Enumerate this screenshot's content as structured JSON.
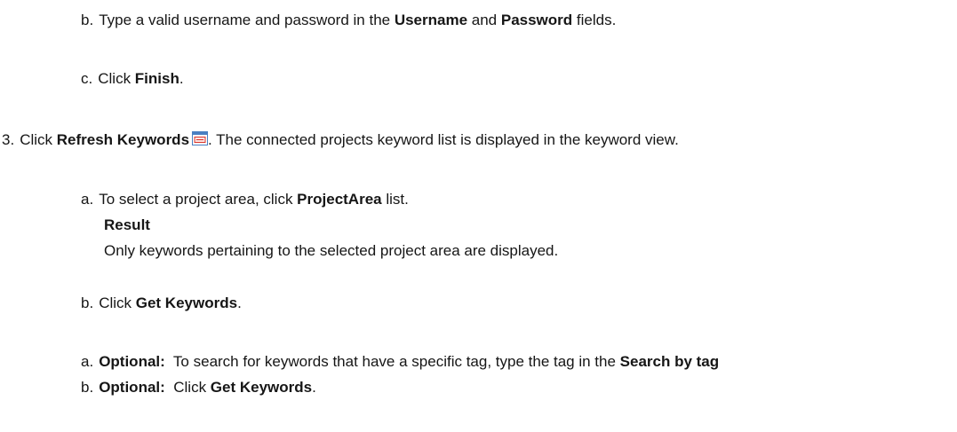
{
  "steps": {
    "b_login": {
      "marker": "b.",
      "t1": "Type a valid username and password in the ",
      "b1": "Username",
      "t2": " and ",
      "b2": "Password",
      "t3": " fields."
    },
    "c_finish": {
      "marker": "c.",
      "t1": "Click ",
      "b1": "Finish",
      "t2": "."
    },
    "step3": {
      "marker": "3.",
      "t1": "Click ",
      "b1": "Refresh Keywords",
      "icon": "refresh-keywords-icon",
      "t2": ". The connected projects keyword list is displayed in the keyword view."
    },
    "a_project": {
      "marker": "a.",
      "t1": "To select a project area, click ",
      "b1": "ProjectArea",
      "t2": " list."
    },
    "result": {
      "heading": "Result",
      "text": "Only keywords pertaining to the selected project area are displayed."
    },
    "b_get": {
      "marker": "b.",
      "t1": "Click ",
      "b1": "Get Keywords",
      "t2": "."
    },
    "a_optional": {
      "marker": "a.",
      "label": "Optional:",
      "t1": "  To search for keywords that have a specific tag, type the tag in the ",
      "b1": "Search by tag"
    },
    "b_optional": {
      "marker": "b.",
      "label": "Optional:",
      "t1": "  Click ",
      "b1": "Get Keywords",
      "t2": "."
    }
  },
  "colors": {
    "text": "#161616",
    "icon_blue": "#4a7fc1",
    "icon_red": "#d9342b"
  }
}
